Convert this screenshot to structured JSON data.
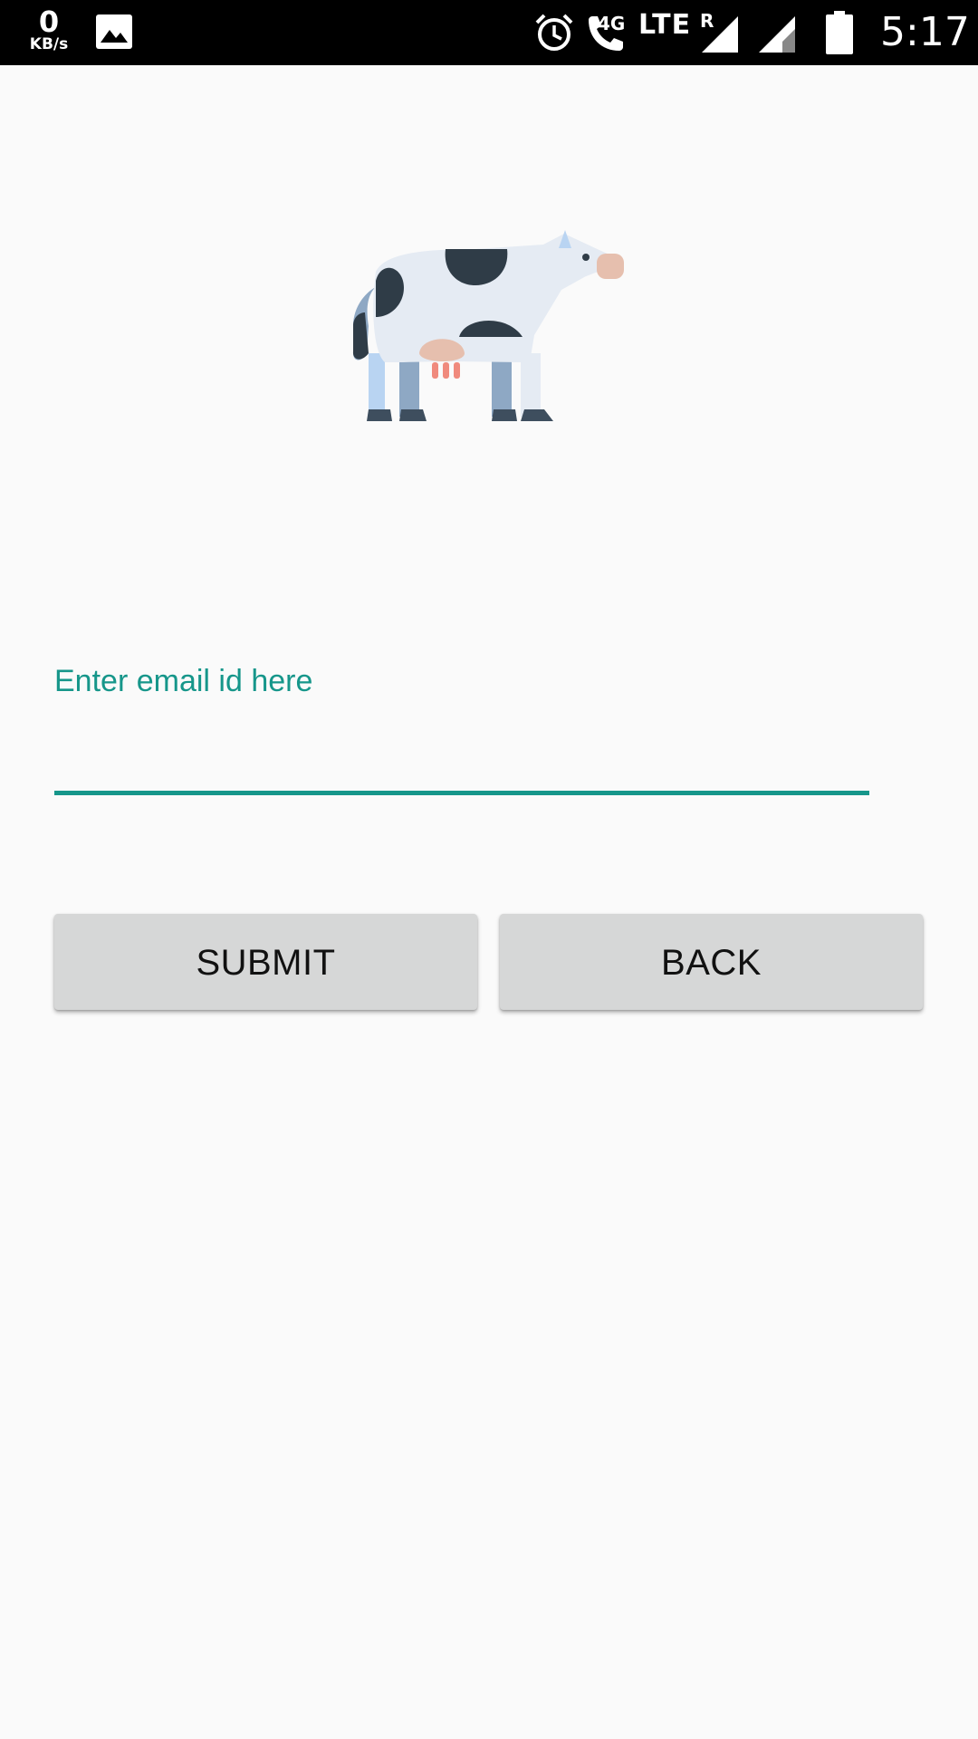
{
  "status_bar": {
    "net_speed_value": "0",
    "net_speed_unit": "KB/s",
    "network_label": "4G",
    "lte_label": "LTE",
    "roaming_label": "R",
    "time": "5:17",
    "icons": [
      "image-icon",
      "alarm-icon",
      "volte-call-icon",
      "signal-icon",
      "signal-icon",
      "battery-icon"
    ]
  },
  "logo": {
    "icon": "cow-icon"
  },
  "email_field": {
    "label": "Enter email id here",
    "value": "",
    "accent_color": "#16968a"
  },
  "buttons": {
    "submit_label": "SUBMIT",
    "back_label": "BACK"
  },
  "colors": {
    "background": "#fafafa",
    "status_bar": "#000000",
    "accent": "#16968a",
    "button_bg": "#d6d7d7"
  }
}
